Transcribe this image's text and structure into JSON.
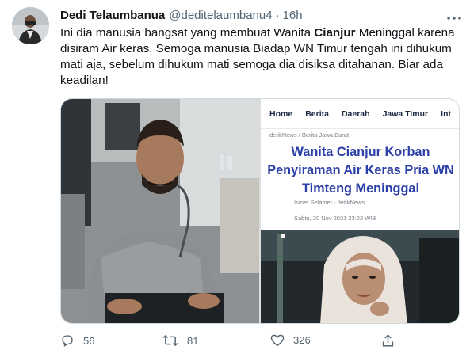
{
  "tweet": {
    "display_name": "Dedi Telaumbanua",
    "handle": "@deditelaumbanu4",
    "separator": "·",
    "time": "16h",
    "text_part1": "Ini dia manusia bangsat yang membuat Wanita ",
    "text_bold": "Cianjur",
    "text_part2": " Meninggal karena disiram Air keras. Semoga manusia Biadap WN Timur tengah ini dihukum mati aja, sebelum dihukum mati semoga dia disiksa ditahanan. Biar ada keadilan!"
  },
  "news_screenshot": {
    "nav": [
      "Home",
      "Berita",
      "Daerah",
      "Jawa Timur",
      "Int"
    ],
    "breadcrumb": "detikNews / Berita Jawa Barat",
    "headline": "Wanita Cianjur Korban Penyiraman Air Keras Pria WN Timteng Meninggal",
    "author": "Ismet Selamet - detikNews",
    "date": "Sabtu, 20 Nov 2021 23:22 WIB"
  },
  "actions": {
    "reply_count": "56",
    "retweet_count": "81",
    "like_count": "326"
  },
  "icons": {
    "more": "more-icon",
    "reply": "reply-icon",
    "retweet": "retweet-icon",
    "like": "like-icon",
    "share": "share-icon"
  },
  "colors": {
    "text": "#0f1419",
    "secondary": "#536471",
    "border": "#cfd9de",
    "headline": "#2b3fa8"
  }
}
